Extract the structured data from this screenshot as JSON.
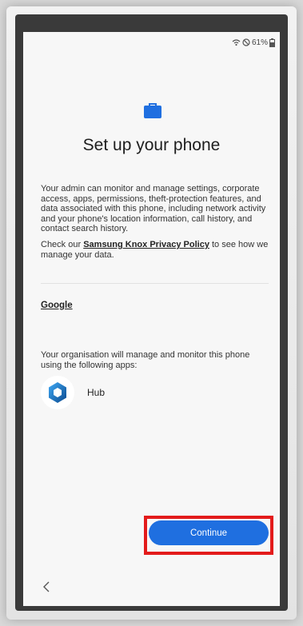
{
  "status_bar": {
    "battery_text": "61%"
  },
  "setup": {
    "title": "Set up your phone",
    "paragraph1": "Your admin can monitor and manage settings, corporate access, apps, permissions, theft-protection features, and data associated with this phone, including network activity and your phone's location information, call history, and contact search history.",
    "paragraph2_prefix": "Check our ",
    "privacy_link": "Samsung Knox Privacy Policy",
    "paragraph2_suffix": " to see how we manage your data.",
    "google_link": "Google",
    "apps_intro": "Your organisation will manage and monitor this phone using the following apps:",
    "apps": [
      {
        "name": "Hub",
        "icon": "hub-app-icon"
      }
    ],
    "continue_label": "Continue"
  },
  "colors": {
    "accent": "#1F6FE0",
    "highlight": "#E31B1B",
    "briefcase": "#1F6FE0"
  }
}
